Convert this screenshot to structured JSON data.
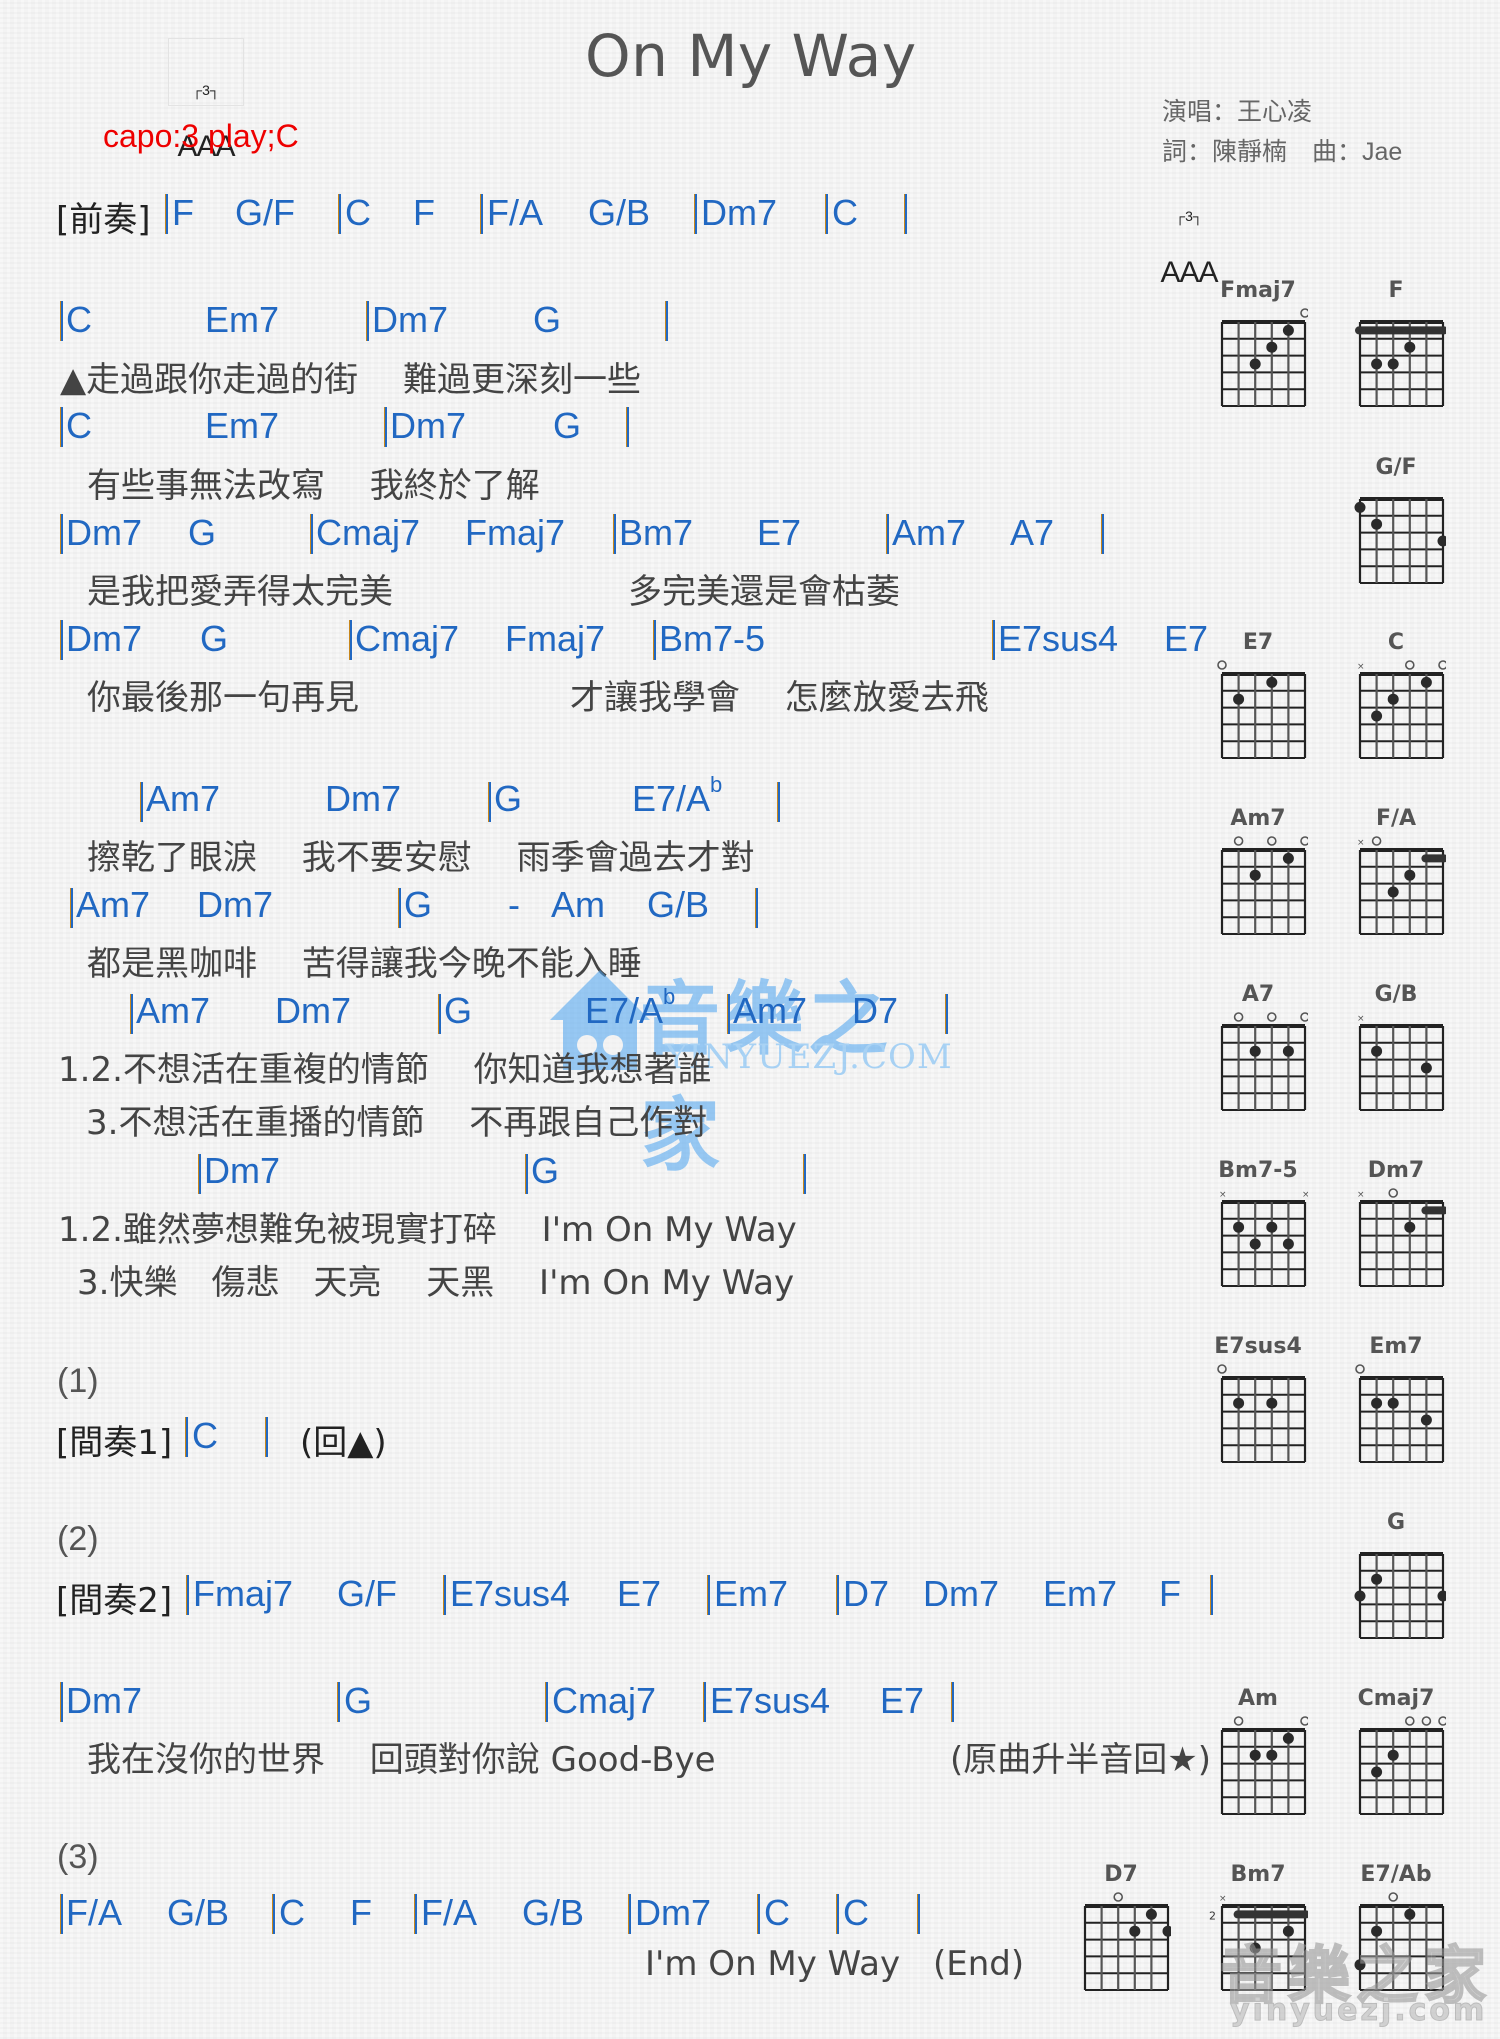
{
  "header": {
    "title": "On My Way",
    "capo": "capo:3 play;C",
    "singer": "演唱：王心凌",
    "credits": "詞：陳靜楠　曲：Jae",
    "rhythm_tuplet": "3",
    "rhythm_notes": "AAA"
  },
  "intro": {
    "label": "[前奏]",
    "chords": [
      "F",
      "G/F",
      "C",
      "F",
      "F/A",
      "G/B",
      "Dm7",
      "C"
    ]
  },
  "verse": {
    "line1_chords": [
      "C",
      "Em7",
      "Dm7",
      "G"
    ],
    "line1_lyric": "▲走過跟你走過的街　 難過更深刻一些",
    "line2_chords": [
      "C",
      "Em7",
      "Dm7",
      "G"
    ],
    "line2_lyric": "有些事無法改寫　 我終於了解",
    "line3_chords": [
      "Dm7",
      "G",
      "Cmaj7",
      "Fmaj7",
      "Bm7",
      "E7",
      "Am7",
      "A7"
    ],
    "line3_lyric_a": "是我把愛弄得太完美",
    "line3_lyric_b": "多完美還是會枯萎",
    "line4_chords": [
      "Dm7",
      "G",
      "Cmaj7",
      "Fmaj7",
      "Bm7-5",
      "E7sus4",
      "E7"
    ],
    "line4_lyric_a": "你最後那一句再見",
    "line4_lyric_b": "才讓我學會　 怎麼放愛去飛"
  },
  "chorus": {
    "line1_chords": [
      "Am7",
      "Dm7",
      "G",
      "E7/A",
      "b"
    ],
    "line1_lyric": "擦乾了眼淚　 我不要安慰　 雨季會過去才對",
    "line2_chords": [
      "Am7",
      "Dm7",
      "G",
      "-",
      "Am",
      "G/B"
    ],
    "line2_lyric": "都是黑咖啡　 苦得讓我今晚不能入睡",
    "line3_chords": [
      "Am7",
      "Dm7",
      "G",
      "E7/A",
      "b",
      "Am7",
      "D7"
    ],
    "line3_lyric_12": "1.2.不想活在重複的情節　 你知道我想著誰",
    "line3_lyric_3": "3.不想活在重播的情節　 不再跟自己作對",
    "line4_chords": [
      "Dm7",
      "G"
    ],
    "line4_lyric_12": "1.2.雖然夢想難免被現實打碎　 I'm On My Way",
    "line4_lyric_3": "3.快樂　傷悲　天亮　 天黑　 I'm On My Way"
  },
  "section1": {
    "marker": "(1)",
    "label": "[間奏1]",
    "chords": [
      "C"
    ],
    "note": "(回▲)"
  },
  "section2": {
    "marker": "(2)",
    "label": "[間奏2]",
    "chords": [
      "Fmaj7",
      "G/F",
      "E7sus4",
      "E7",
      "Em7",
      "D7",
      "Dm7",
      "Em7",
      "F"
    ],
    "bridge_chords": [
      "Dm7",
      "G",
      "Cmaj7",
      "E7sus4",
      "E7"
    ],
    "bridge_lyric": "我在沒你的世界　 回頭對你說 Good-Bye",
    "bridge_note": "(原曲升半音回★)"
  },
  "section3": {
    "marker": "(3)",
    "chords": [
      "F/A",
      "G/B",
      "C",
      "F",
      "F/A",
      "G/B",
      "Dm7",
      "C",
      "C"
    ],
    "lyric": "I'm On My Way",
    "end": "(End)"
  },
  "watermark": {
    "center_text": "音樂之家",
    "center_url": "YINYUEZJ.COM",
    "corner_text": "音樂之家",
    "corner_url": "yinyuezj.com"
  },
  "colors": {
    "chord": "#2168c2",
    "capo": "#e00000",
    "lyric": "#444444",
    "title": "#555555"
  },
  "diagrams": [
    {
      "name": "Fmaj7",
      "top": [
        "",
        "",
        "",
        "",
        "",
        "o"
      ],
      "barre": null,
      "dots": [
        [
          2,
          3
        ],
        [
          3,
          2
        ],
        [
          4,
          1
        ]
      ],
      "fret_label": ""
    },
    {
      "name": "F",
      "top": [
        "",
        "",
        "",
        "",
        "",
        ""
      ],
      "barre": [
        1,
        0,
        5
      ],
      "dots": [
        [
          1,
          3
        ],
        [
          2,
          3
        ],
        [
          3,
          2
        ]
      ],
      "fret_label": ""
    },
    {
      "name": "G/F",
      "top": [
        "",
        "",
        "",
        "",
        "",
        ""
      ],
      "barre": null,
      "dots": [
        [
          0,
          1
        ],
        [
          1,
          2
        ],
        [
          5,
          3
        ]
      ],
      "fret_label": ""
    },
    {
      "name": "E7",
      "top": [
        "o",
        "",
        "",
        "",
        "",
        ""
      ],
      "barre": null,
      "dots": [
        [
          1,
          2
        ],
        [
          3,
          1
        ]
      ],
      "fret_label": ""
    },
    {
      "name": "C",
      "top": [
        "x",
        "",
        "",
        "o",
        "",
        "o"
      ],
      "barre": null,
      "dots": [
        [
          1,
          3
        ],
        [
          2,
          2
        ],
        [
          4,
          1
        ]
      ],
      "fret_label": ""
    },
    {
      "name": "Am7",
      "top": [
        "",
        "o",
        "",
        "o",
        "",
        "o"
      ],
      "barre": null,
      "dots": [
        [
          2,
          2
        ],
        [
          4,
          1
        ]
      ],
      "fret_label": ""
    },
    {
      "name": "F/A",
      "top": [
        "x",
        "o",
        "",
        "",
        "",
        ""
      ],
      "barre": [
        1,
        4,
        5
      ],
      "dots": [
        [
          2,
          3
        ],
        [
          3,
          2
        ]
      ],
      "fret_label": ""
    },
    {
      "name": "A7",
      "top": [
        "",
        "o",
        "",
        "o",
        "",
        "o"
      ],
      "barre": null,
      "dots": [
        [
          2,
          2
        ],
        [
          4,
          2
        ]
      ],
      "fret_label": ""
    },
    {
      "name": "G/B",
      "top": [
        "x",
        "",
        "",
        "",
        "",
        ""
      ],
      "barre": null,
      "dots": [
        [
          1,
          2
        ],
        [
          4,
          3
        ]
      ],
      "fret_label": ""
    },
    {
      "name": "Bm7-5",
      "top": [
        "x",
        "",
        "",
        "",
        "",
        "x"
      ],
      "barre": null,
      "dots": [
        [
          1,
          2
        ],
        [
          2,
          3
        ],
        [
          3,
          2
        ],
        [
          4,
          3
        ]
      ],
      "fret_label": ""
    },
    {
      "name": "Dm7",
      "top": [
        "x",
        "",
        "o",
        "",
        "",
        ""
      ],
      "barre": [
        1,
        4,
        5
      ],
      "dots": [
        [
          3,
          2
        ]
      ],
      "fret_label": ""
    },
    {
      "name": "E7sus4",
      "top": [
        "o",
        "",
        "",
        "",
        "",
        ""
      ],
      "barre": null,
      "dots": [
        [
          1,
          2
        ],
        [
          3,
          2
        ]
      ],
      "fret_label": ""
    },
    {
      "name": "Em7",
      "top": [
        "o",
        "",
        "",
        "",
        "",
        ""
      ],
      "barre": null,
      "dots": [
        [
          1,
          2
        ],
        [
          2,
          2
        ],
        [
          4,
          3
        ]
      ],
      "fret_label": ""
    },
    {
      "name": "G",
      "top": [
        "",
        "",
        "",
        "",
        "",
        ""
      ],
      "barre": null,
      "dots": [
        [
          0,
          3
        ],
        [
          1,
          2
        ],
        [
          5,
          3
        ]
      ],
      "fret_label": ""
    },
    {
      "name": "Am",
      "top": [
        "",
        "o",
        "",
        "",
        "",
        "o"
      ],
      "barre": null,
      "dots": [
        [
          2,
          2
        ],
        [
          3,
          2
        ],
        [
          4,
          1
        ]
      ],
      "fret_label": ""
    },
    {
      "name": "Cmaj7",
      "top": [
        "",
        "",
        "",
        "o",
        "o",
        "o"
      ],
      "barre": null,
      "dots": [
        [
          1,
          3
        ],
        [
          2,
          2
        ]
      ],
      "fret_label": ""
    },
    {
      "name": "D7",
      "top": [
        "",
        "",
        "o",
        "",
        "",
        ""
      ],
      "barre": null,
      "dots": [
        [
          3,
          2
        ],
        [
          4,
          1
        ],
        [
          5,
          2
        ]
      ],
      "fret_label": ""
    },
    {
      "name": "Bm7",
      "top": [
        "x",
        "",
        "",
        "",
        "",
        ""
      ],
      "barre": [
        1,
        1,
        5
      ],
      "dots": [
        [
          2,
          3
        ],
        [
          4,
          2
        ]
      ],
      "fret_label": "2"
    },
    {
      "name": "E7/Ab",
      "top": [
        "",
        "",
        "o",
        "",
        "",
        ""
      ],
      "barre": null,
      "dots": [
        [
          0,
          4
        ],
        [
          1,
          2
        ],
        [
          3,
          1
        ]
      ],
      "fret_label": ""
    }
  ]
}
